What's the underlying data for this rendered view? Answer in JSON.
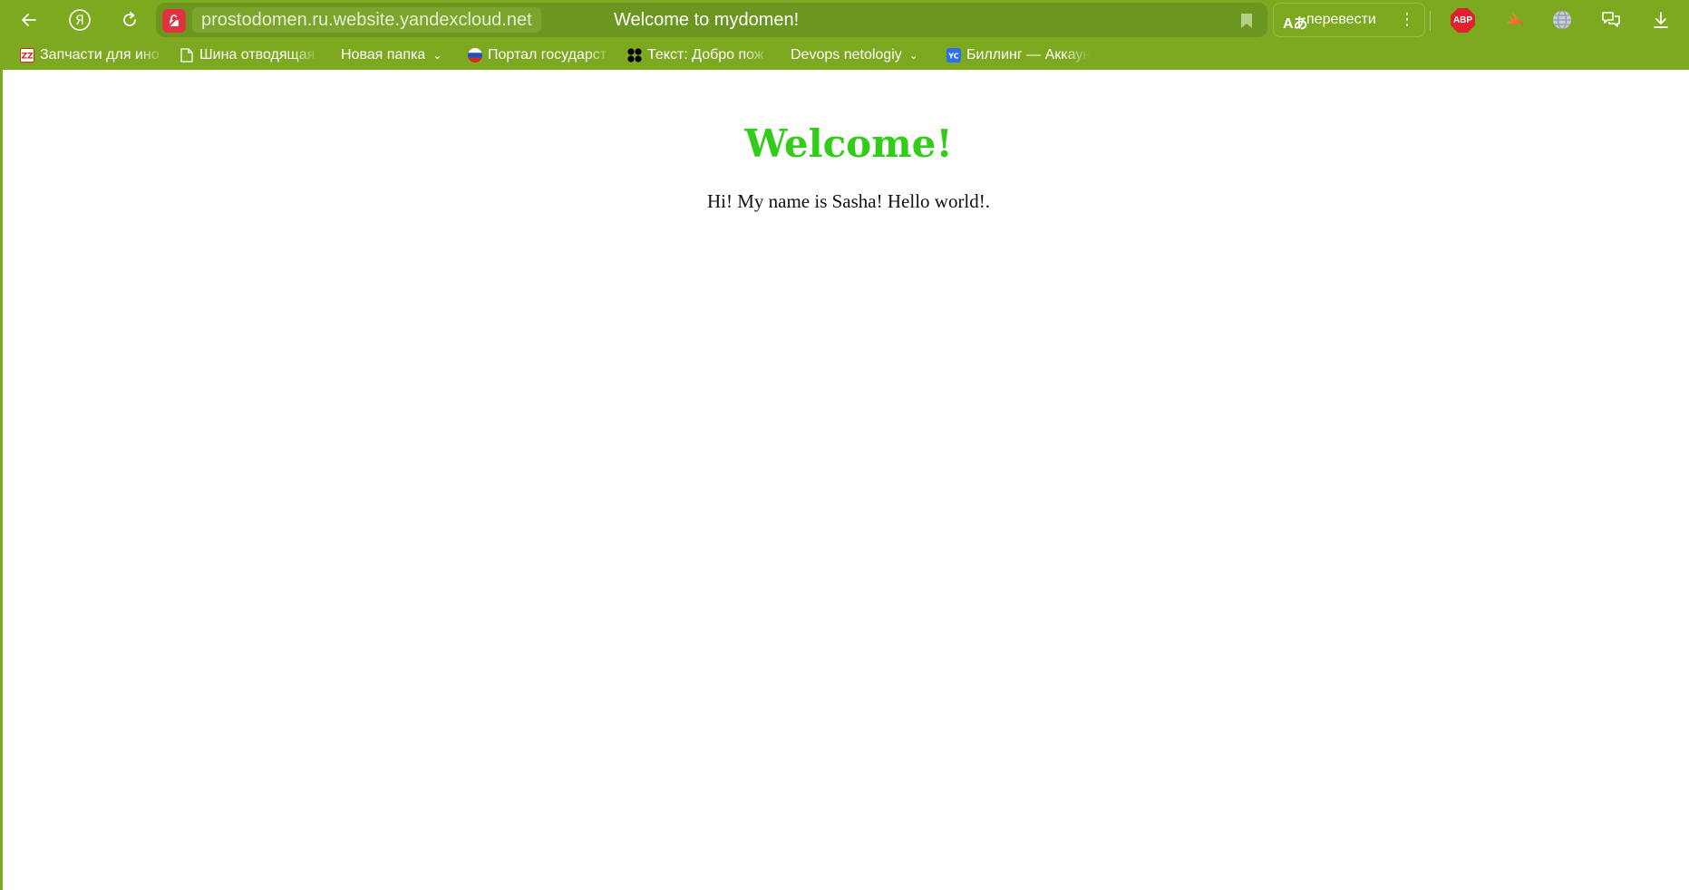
{
  "browser": {
    "url": "prostodomen.ru.website.yandexcloud.net",
    "tab_title": "Welcome to mydomen!",
    "translate_label": "перевести",
    "translate_icon": "Aあ",
    "abp_label": "ABP",
    "menu_dots": "⋮"
  },
  "bookmarks": [
    {
      "label": "Запчасти для ино",
      "icon": "zz-icon",
      "icon_text": "ZZ"
    },
    {
      "label": "Шина отводящая",
      "icon": "page-icon"
    },
    {
      "label": "Новая папка",
      "icon": "folder",
      "caret": "⌄"
    },
    {
      "label": "Портал государст",
      "icon": "russia-flag-icon"
    },
    {
      "label": "Текст: Добро пож",
      "icon": "dots-icon"
    },
    {
      "label": "Devops netologiy",
      "icon": "folder",
      "caret": "⌄"
    },
    {
      "label": "Биллинг — Аккаун",
      "icon": "yc-icon",
      "icon_text": "YC"
    }
  ],
  "page": {
    "heading": "Welcome!",
    "text": "Hi! My name is Sasha! Hello world!."
  },
  "colors": {
    "chrome": "#7ca91f",
    "heading": "#33cc1a",
    "abp": "#e0212e",
    "lock_badge": "#e3323f"
  }
}
